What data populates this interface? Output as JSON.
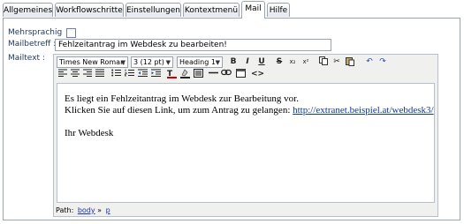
{
  "tabs": [
    "Allgemeines",
    "Workflowschritte",
    "Einstellungen",
    "Kontextmenü",
    "Mail",
    "Hilfe"
  ],
  "active_tab": "Mail",
  "form": {
    "mehrsprachig_label": "Mehrsprachig",
    "mailbetreff_label": "Mailbetreff :",
    "mailbetreff_value": "Fehlzeitantrag im Webdesk zu bearbeiten!",
    "mailtext_label": "Mailtext :"
  },
  "toolbar": {
    "font_family": "Times New Roman",
    "font_size": "3 (12 pt)",
    "format": "Heading 1",
    "bold": "B",
    "italic": "I",
    "underline": "U",
    "strike": "S",
    "subscript": "x₂",
    "superscript": "x²",
    "link": "link-icon",
    "source": "<>"
  },
  "content": {
    "line1": "Es liegt ein Fehlzeitantrag im Webdesk zur Bearbeitung vor.",
    "line2_text": "Klicken Sie auf diesen Link, um zum Antrag zu gelangen: ",
    "line2_link": "http://extranet.beispiel.at/webdesk3/",
    "line3": "Ihr Webdesk"
  },
  "path": {
    "label": "Path:",
    "body": "body",
    "sep": "»",
    "p": "p"
  }
}
